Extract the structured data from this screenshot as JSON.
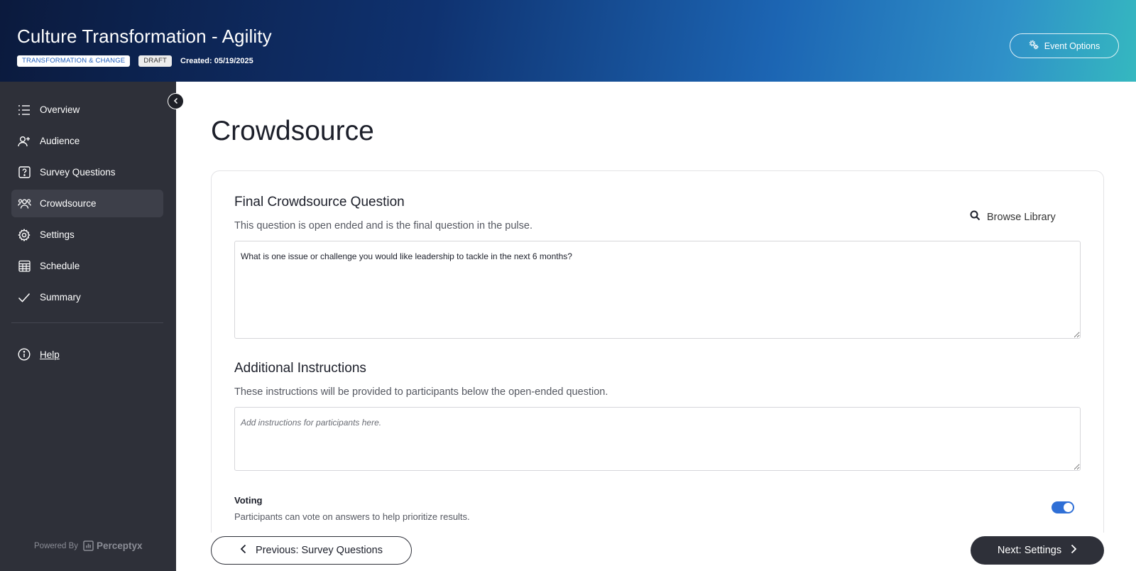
{
  "header": {
    "title": "Culture Transformation - Agility",
    "category_badge": "TRANSFORMATION & CHANGE",
    "status_badge": "DRAFT",
    "created": "Created: 05/19/2025",
    "event_options_label": "Event Options"
  },
  "sidebar": {
    "items": [
      {
        "label": "Overview",
        "icon": "list-icon",
        "active": false
      },
      {
        "label": "Audience",
        "icon": "user-plus-icon",
        "active": false
      },
      {
        "label": "Survey Questions",
        "icon": "question-box-icon",
        "active": false
      },
      {
        "label": "Crowdsource",
        "icon": "users-icon",
        "active": true
      },
      {
        "label": "Settings",
        "icon": "gear-icon",
        "active": false
      },
      {
        "label": "Schedule",
        "icon": "calendar-icon",
        "active": false
      },
      {
        "label": "Summary",
        "icon": "check-icon",
        "active": false
      }
    ],
    "help_label": "Help",
    "powered_by": "Powered By",
    "brand": "Perceptyx"
  },
  "main": {
    "page_title": "Crowdsource",
    "question_section": {
      "title": "Final Crowdsource Question",
      "description": "This question is open ended and is the final question in the pulse.",
      "browse_label": "Browse Library",
      "value": "What is one issue or challenge you would like leadership to tackle in the next 6 months?"
    },
    "instructions_section": {
      "title": "Additional Instructions",
      "description": "These instructions will be provided to participants below the open-ended question.",
      "placeholder": "Add instructions for participants here.",
      "value": ""
    },
    "voting": {
      "label": "Voting",
      "description": "Participants can vote on answers to help prioritize results.",
      "enabled": true
    },
    "prev_button": "Previous: Survey Questions",
    "next_button": "Next: Settings"
  },
  "colors": {
    "sidebar_bg": "#2e3039",
    "accent": "#2f6fd6",
    "header_gradient_start": "#0b1a3d",
    "header_gradient_end": "#35b8c0"
  }
}
